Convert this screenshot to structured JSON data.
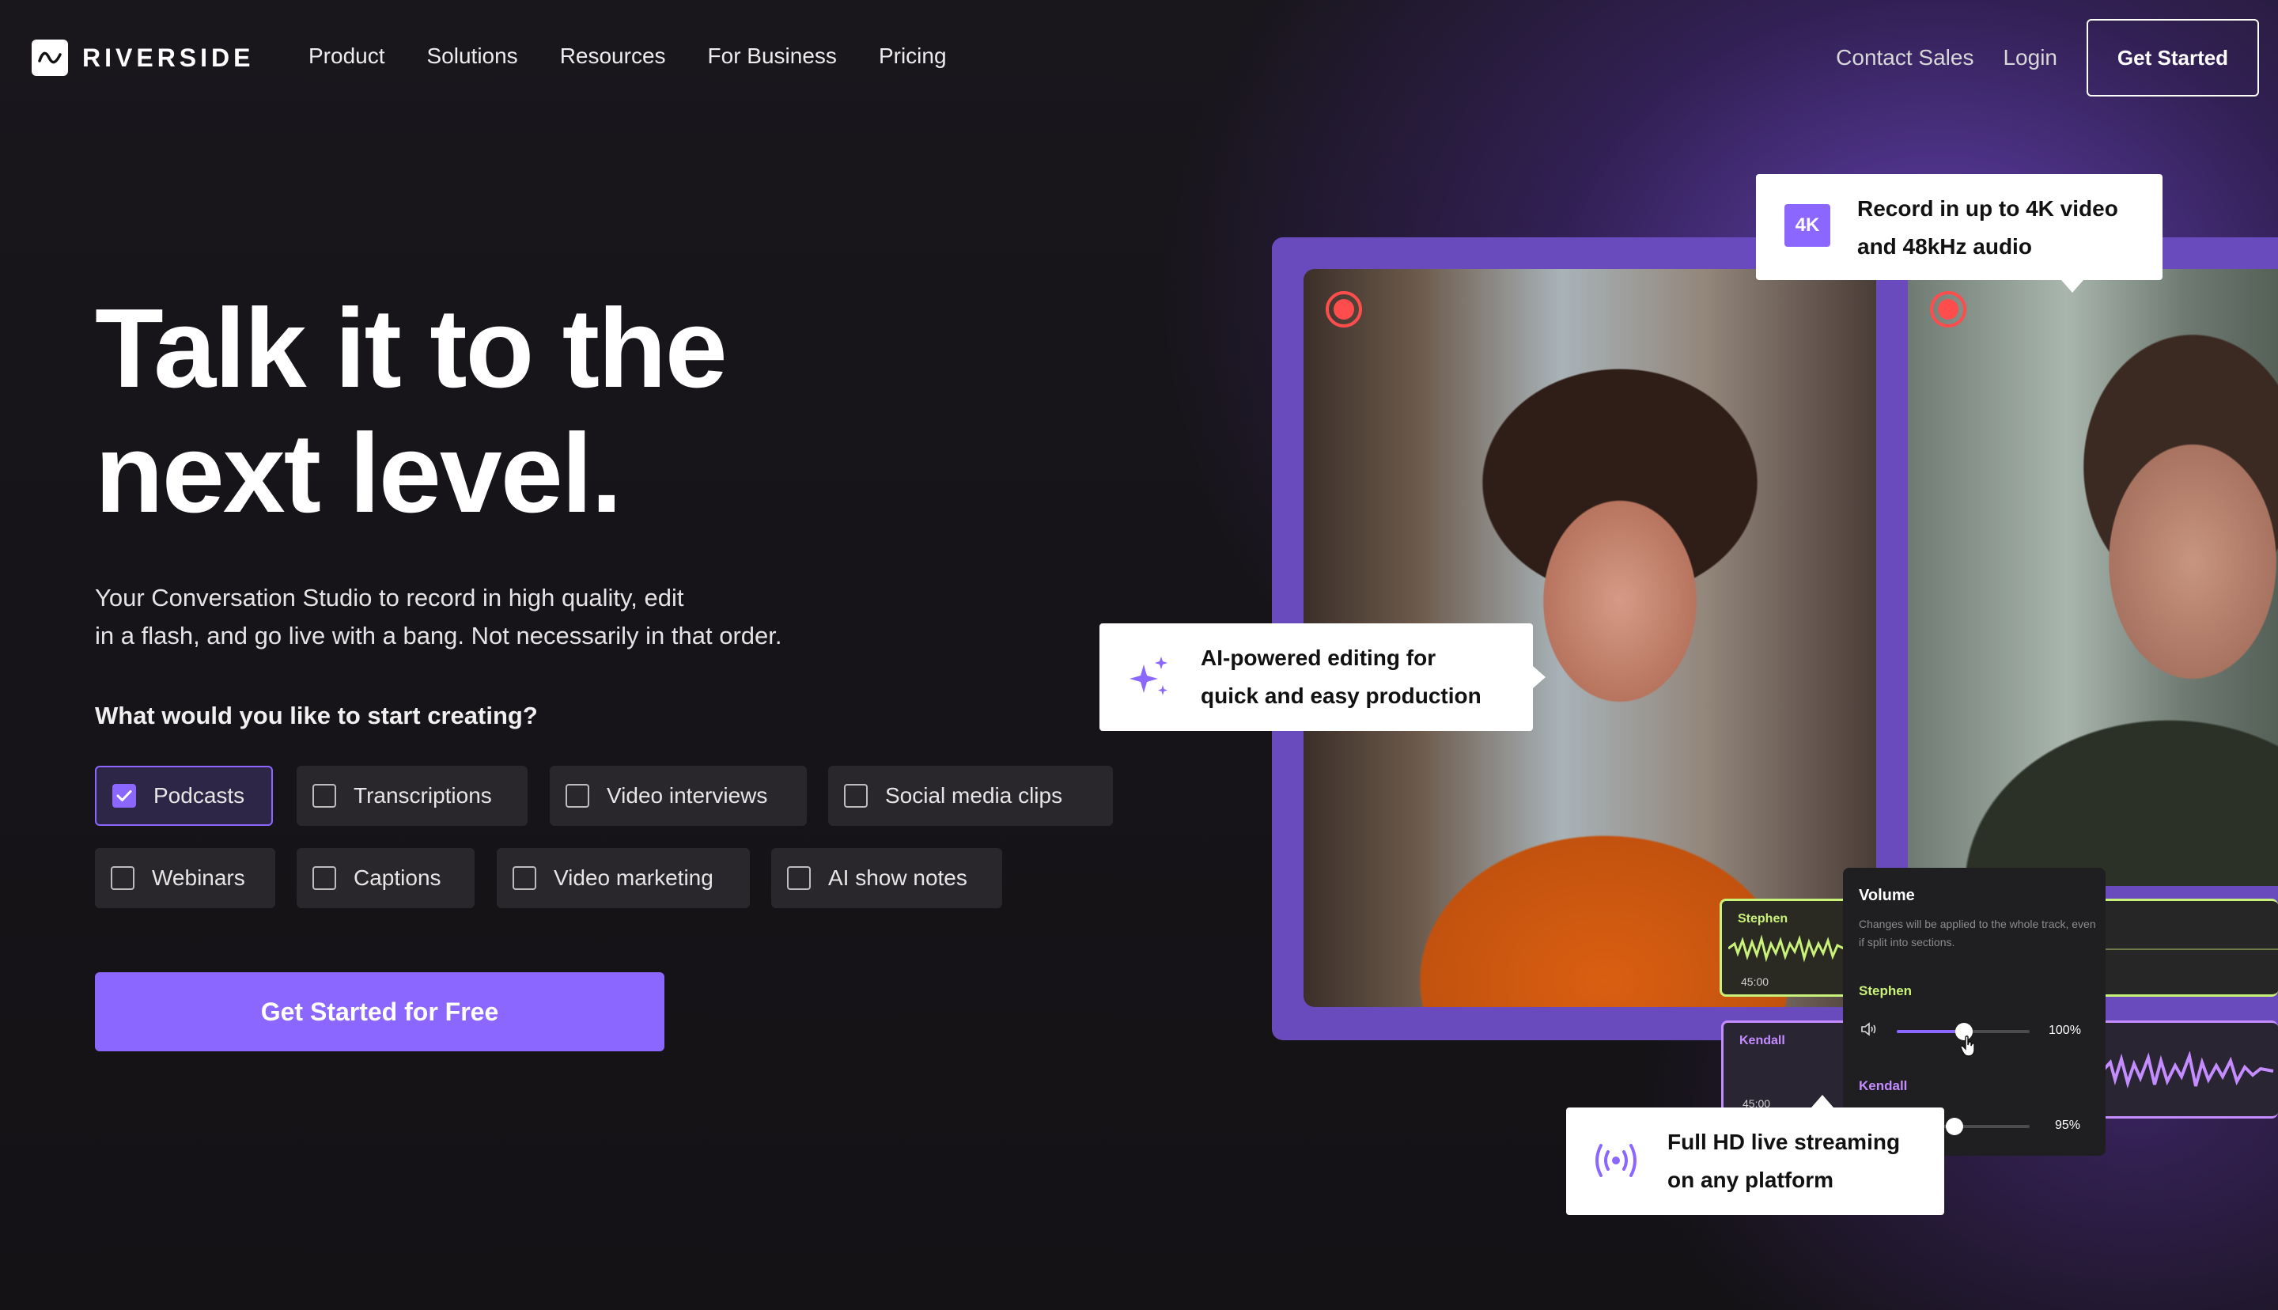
{
  "nav": {
    "brand": "RIVERSIDE",
    "menu": [
      "Product",
      "Solutions",
      "Resources",
      "For Business",
      "Pricing"
    ],
    "contact": "Contact Sales",
    "login": "Login",
    "get_started": "Get Started"
  },
  "hero": {
    "headline_line1": "Talk it to the",
    "headline_line2": "next level.",
    "subtitle_line1": "Your Conversation Studio to record in high quality, edit",
    "subtitle_line2": "in a flash, and go live with a bang. Not necessarily in that order.",
    "question": "What would you like to start creating?",
    "options": [
      {
        "label": "Podcasts",
        "checked": true
      },
      {
        "label": "Transcriptions",
        "checked": false
      },
      {
        "label": "Video interviews",
        "checked": false
      },
      {
        "label": "Social media clips",
        "checked": false
      },
      {
        "label": "Webinars",
        "checked": false
      },
      {
        "label": "Captions",
        "checked": false
      },
      {
        "label": "Video marketing",
        "checked": false
      },
      {
        "label": "AI show notes",
        "checked": false
      }
    ],
    "cta": "Get Started for Free"
  },
  "visual": {
    "callout_4k": {
      "badge": "4K",
      "line1": "Record in up to 4K video",
      "line2": "and 48kHz audio"
    },
    "callout_ai": {
      "line1": "AI-powered editing for",
      "line2": "quick and easy production"
    },
    "callout_live": {
      "line1": "Full HD live streaming",
      "line2": "on any platform"
    },
    "tracks": [
      {
        "name": "Stephen",
        "time": "45:00"
      },
      {
        "name": "Kendall",
        "time": "45:00"
      }
    ],
    "volume": {
      "title": "Volume",
      "description": "Changes will be applied to the whole track, even if split into sections.",
      "speakers": [
        {
          "name": "Stephen",
          "percent": "100%",
          "level": 0.45
        },
        {
          "name": "Kendall",
          "percent": "95%",
          "level": 0.4
        }
      ]
    }
  },
  "colors": {
    "accent": "#8b67ff",
    "stephen": "#c9f27a",
    "kendall": "#c48cff",
    "record": "#ff4d4d"
  }
}
